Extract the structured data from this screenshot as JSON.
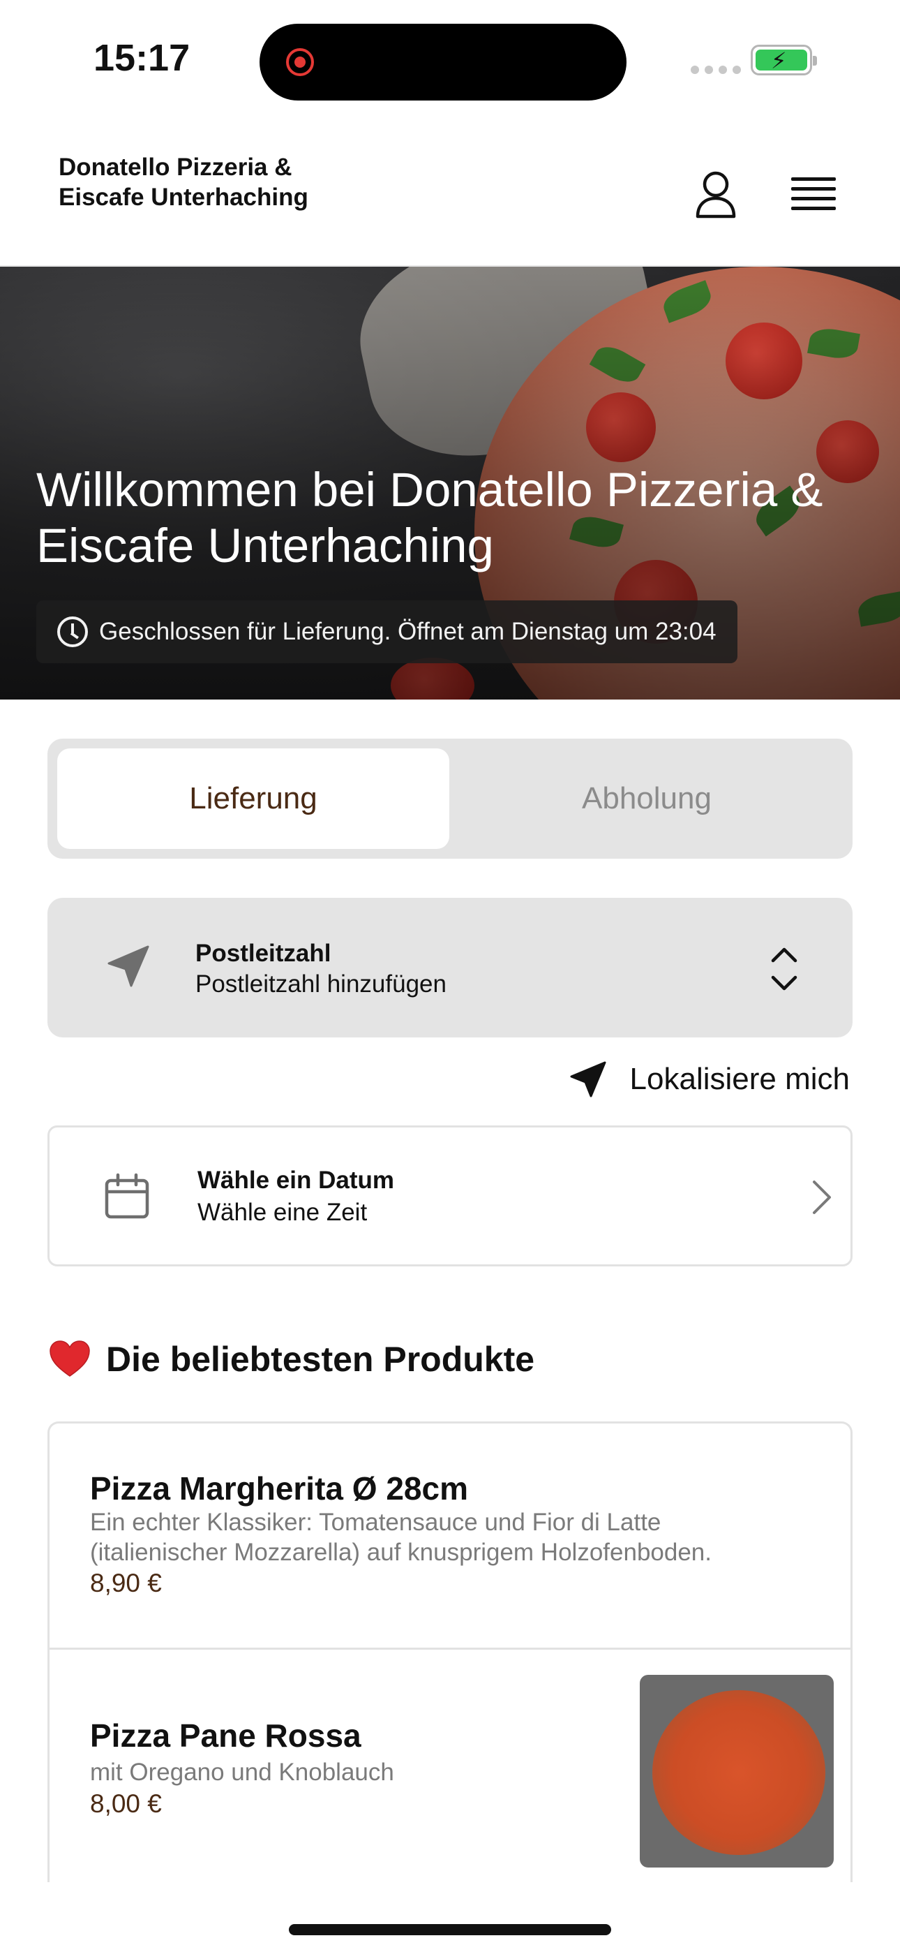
{
  "status_bar": {
    "time": "15:17"
  },
  "header": {
    "brand_name": "Donatello Pizzeria & Eiscafe Unterhaching",
    "user_icon": "user-icon",
    "menu_icon": "hamburger-menu-icon"
  },
  "hero": {
    "title": "Willkommen bei Donatello Pizzeria & Eiscafe Unterhaching",
    "status_text": "Geschlossen für Lieferung. Öffnet am Dienstag um 23:04",
    "status_icon": "clock-icon"
  },
  "order_mode": {
    "options": [
      {
        "label": "Lieferung",
        "selected": true
      },
      {
        "label": "Abholung",
        "selected": false
      }
    ]
  },
  "postal_code": {
    "label": "Postleitzahl",
    "value": "Postleitzahl hinzufügen",
    "icon": "navigation-arrow-icon",
    "toggle_icon": "chevron-up-down-icon"
  },
  "locate": {
    "label": "Lokalisiere mich",
    "icon": "location-arrow-icon"
  },
  "schedule": {
    "label": "Wähle ein Datum",
    "value": "Wähle eine Zeit",
    "icon": "calendar-icon",
    "chevron_icon": "chevron-right-icon"
  },
  "popular": {
    "title": "Die beliebtesten Produkte",
    "icon": "heart-icon",
    "products": [
      {
        "name": "Pizza Margherita Ø 28cm",
        "description": "Ein echter Klassiker: Tomatensauce und Fior di Latte (italienischer Mozzarella) auf knusprigem Holzofenboden.",
        "price": "8,90 €"
      },
      {
        "name": "Pizza Pane Rossa",
        "description": "mit Oregano und Knoblauch",
        "price": "8,00 €"
      }
    ]
  },
  "colors": {
    "accent_brown": "#4a2a14",
    "panel_grey": "#e4e4e4",
    "border_grey": "#e2e2e2",
    "muted_text": "#7a7a7a"
  }
}
